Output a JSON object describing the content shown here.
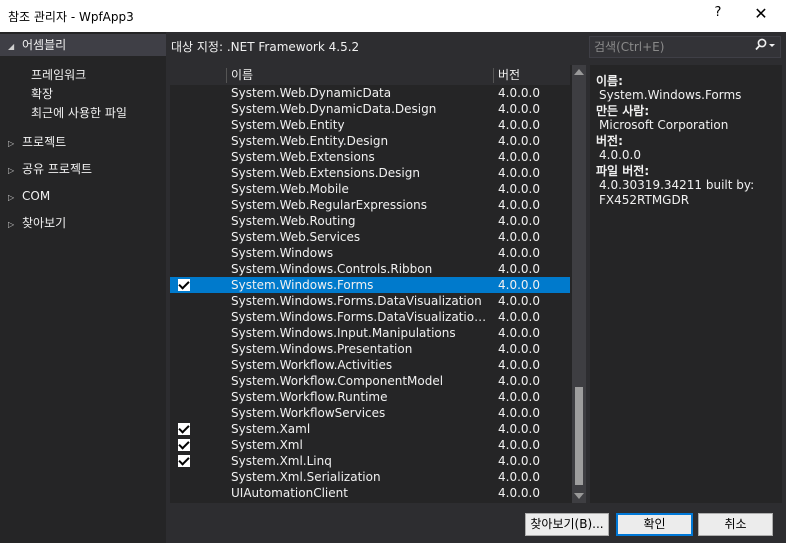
{
  "window": {
    "title": "참조 관리자 - WpfApp3",
    "help": "?",
    "close": "✕"
  },
  "left": {
    "assemblies": "어셈블리",
    "sub": [
      "프레임워크",
      "확장",
      "최근에 사용한 파일"
    ],
    "projects": "프로젝트",
    "shared": "공유 프로젝트",
    "com": "COM",
    "browse": "찾아보기"
  },
  "target": {
    "label": "대상 지정:",
    "value": ".NET Framework 4.5.2"
  },
  "search": {
    "placeholder": "검색(Ctrl+E)",
    "icon": "search-icon"
  },
  "list": {
    "col_name": "이름",
    "col_version": "버전",
    "rows": [
      {
        "name": "System.Web.DynamicData",
        "version": "4.0.0.0",
        "checked": false,
        "selected": false
      },
      {
        "name": "System.Web.DynamicData.Design",
        "version": "4.0.0.0",
        "checked": false,
        "selected": false
      },
      {
        "name": "System.Web.Entity",
        "version": "4.0.0.0",
        "checked": false,
        "selected": false
      },
      {
        "name": "System.Web.Entity.Design",
        "version": "4.0.0.0",
        "checked": false,
        "selected": false
      },
      {
        "name": "System.Web.Extensions",
        "version": "4.0.0.0",
        "checked": false,
        "selected": false
      },
      {
        "name": "System.Web.Extensions.Design",
        "version": "4.0.0.0",
        "checked": false,
        "selected": false
      },
      {
        "name": "System.Web.Mobile",
        "version": "4.0.0.0",
        "checked": false,
        "selected": false
      },
      {
        "name": "System.Web.RegularExpressions",
        "version": "4.0.0.0",
        "checked": false,
        "selected": false
      },
      {
        "name": "System.Web.Routing",
        "version": "4.0.0.0",
        "checked": false,
        "selected": false
      },
      {
        "name": "System.Web.Services",
        "version": "4.0.0.0",
        "checked": false,
        "selected": false
      },
      {
        "name": "System.Windows",
        "version": "4.0.0.0",
        "checked": false,
        "selected": false
      },
      {
        "name": "System.Windows.Controls.Ribbon",
        "version": "4.0.0.0",
        "checked": false,
        "selected": false
      },
      {
        "name": "System.Windows.Forms",
        "version": "4.0.0.0",
        "checked": true,
        "selected": true
      },
      {
        "name": "System.Windows.Forms.DataVisualization",
        "version": "4.0.0.0",
        "checked": false,
        "selected": false
      },
      {
        "name": "System.Windows.Forms.DataVisualization.Des...",
        "version": "4.0.0.0",
        "checked": false,
        "selected": false
      },
      {
        "name": "System.Windows.Input.Manipulations",
        "version": "4.0.0.0",
        "checked": false,
        "selected": false
      },
      {
        "name": "System.Windows.Presentation",
        "version": "4.0.0.0",
        "checked": false,
        "selected": false
      },
      {
        "name": "System.Workflow.Activities",
        "version": "4.0.0.0",
        "checked": false,
        "selected": false
      },
      {
        "name": "System.Workflow.ComponentModel",
        "version": "4.0.0.0",
        "checked": false,
        "selected": false
      },
      {
        "name": "System.Workflow.Runtime",
        "version": "4.0.0.0",
        "checked": false,
        "selected": false
      },
      {
        "name": "System.WorkflowServices",
        "version": "4.0.0.0",
        "checked": false,
        "selected": false
      },
      {
        "name": "System.Xaml",
        "version": "4.0.0.0",
        "checked": true,
        "selected": false
      },
      {
        "name": "System.Xml",
        "version": "4.0.0.0",
        "checked": true,
        "selected": false
      },
      {
        "name": "System.Xml.Linq",
        "version": "4.0.0.0",
        "checked": true,
        "selected": false
      },
      {
        "name": "System.Xml.Serialization",
        "version": "4.0.0.0",
        "checked": false,
        "selected": false
      },
      {
        "name": "UIAutomationClient",
        "version": "4.0.0.0",
        "checked": false,
        "selected": false
      }
    ]
  },
  "details": {
    "name_label": "이름:",
    "name_value": "System.Windows.Forms",
    "author_label": "만든 사람:",
    "author_value": "Microsoft Corporation",
    "version_label": "버전:",
    "version_value": "4.0.0.0",
    "file_version_label": "파일 버전:",
    "file_version_value": "4.0.30319.34211 built by:",
    "file_version_value2": "FX452RTMGDR"
  },
  "buttons": {
    "browse": "찾아보기(B)...",
    "ok": "확인",
    "cancel": "취소"
  }
}
